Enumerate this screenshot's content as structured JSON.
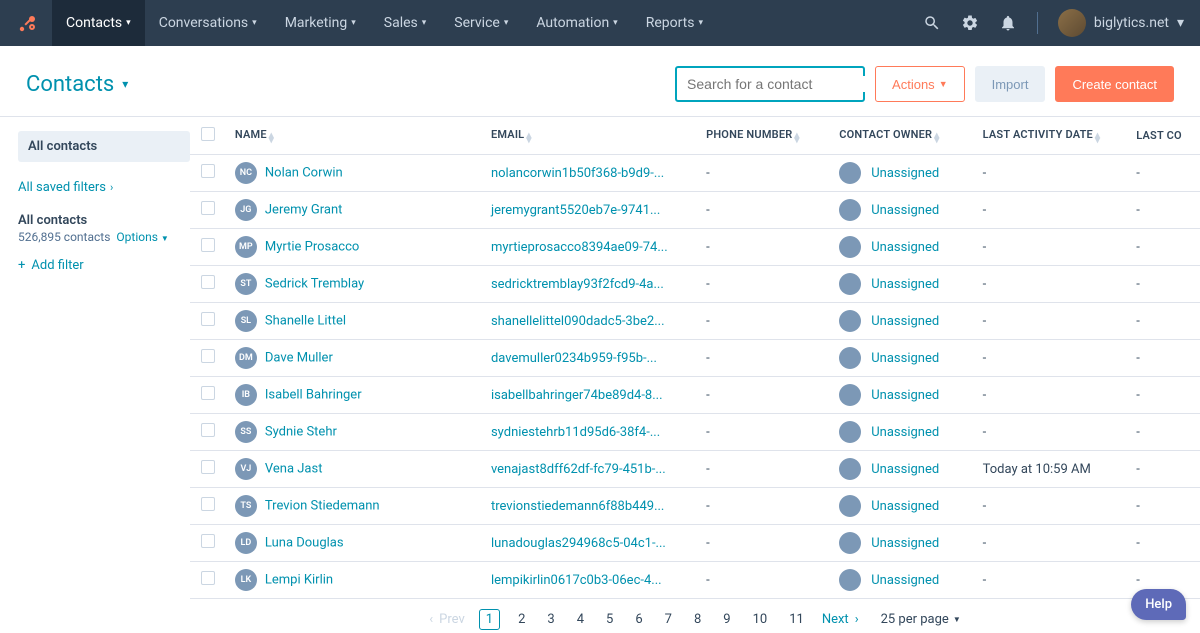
{
  "nav": {
    "items": [
      {
        "label": "Contacts",
        "active": true
      },
      {
        "label": "Conversations"
      },
      {
        "label": "Marketing"
      },
      {
        "label": "Sales"
      },
      {
        "label": "Service"
      },
      {
        "label": "Automation"
      },
      {
        "label": "Reports"
      }
    ],
    "account": "biglytics.net"
  },
  "page": {
    "title": "Contacts",
    "search_placeholder": "Search for a contact",
    "actions_label": "Actions",
    "import_label": "Import",
    "create_label": "Create contact"
  },
  "sidebar": {
    "all_contacts": "All contacts",
    "saved_filters": "All saved filters",
    "current": {
      "title": "All contacts",
      "count": "526,895 contacts",
      "options": "Options"
    },
    "add_filter": "Add filter"
  },
  "table": {
    "columns": [
      "NAME",
      "EMAIL",
      "PHONE NUMBER",
      "CONTACT OWNER",
      "LAST ACTIVITY DATE",
      "LAST CO"
    ],
    "rows": [
      {
        "initials": "NC",
        "name": "Nolan Corwin",
        "email": "nolancorwin1b50f368-b9d9-...",
        "phone": "-",
        "owner": "Unassigned",
        "activity": "-",
        "lastc": "-"
      },
      {
        "initials": "JG",
        "name": "Jeremy Grant",
        "email": "jeremygrant5520eb7e-9741...",
        "phone": "-",
        "owner": "Unassigned",
        "activity": "-",
        "lastc": "-"
      },
      {
        "initials": "MP",
        "name": "Myrtie Prosacco",
        "email": "myrtieprosacco8394ae09-74...",
        "phone": "-",
        "owner": "Unassigned",
        "activity": "-",
        "lastc": "-"
      },
      {
        "initials": "ST",
        "name": "Sedrick Tremblay",
        "email": "sedricktremblay93f2fcd9-4a...",
        "phone": "-",
        "owner": "Unassigned",
        "activity": "-",
        "lastc": "-"
      },
      {
        "initials": "SL",
        "name": "Shanelle Littel",
        "email": "shanellelittel090dadc5-3be2...",
        "phone": "-",
        "owner": "Unassigned",
        "activity": "-",
        "lastc": "-"
      },
      {
        "initials": "DM",
        "name": "Dave Muller",
        "email": "davemuller0234b959-f95b-...",
        "phone": "-",
        "owner": "Unassigned",
        "activity": "-",
        "lastc": "-"
      },
      {
        "initials": "IB",
        "name": "Isabell Bahringer",
        "email": "isabellbahringer74be89d4-8...",
        "phone": "-",
        "owner": "Unassigned",
        "activity": "-",
        "lastc": "-"
      },
      {
        "initials": "SS",
        "name": "Sydnie Stehr",
        "email": "sydniestehrb11d95d6-38f4-...",
        "phone": "-",
        "owner": "Unassigned",
        "activity": "-",
        "lastc": "-"
      },
      {
        "initials": "VJ",
        "name": "Vena Jast",
        "email": "venajast8dff62df-fc79-451b-...",
        "phone": "-",
        "owner": "Unassigned",
        "activity": "Today at 10:59 AM",
        "lastc": "-"
      },
      {
        "initials": "TS",
        "name": "Trevion Stiedemann",
        "email": "trevionstiedemann6f88b449...",
        "phone": "-",
        "owner": "Unassigned",
        "activity": "-",
        "lastc": "-"
      },
      {
        "initials": "LD",
        "name": "Luna Douglas",
        "email": "lunadouglas294968c5-04c1-...",
        "phone": "-",
        "owner": "Unassigned",
        "activity": "-",
        "lastc": "-"
      },
      {
        "initials": "LK",
        "name": "Lempi Kirlin",
        "email": "lempikirlin0617c0b3-06ec-4...",
        "phone": "-",
        "owner": "Unassigned",
        "activity": "-",
        "lastc": "-"
      }
    ]
  },
  "pager": {
    "prev": "Prev",
    "next": "Next",
    "pages": [
      "1",
      "2",
      "3",
      "4",
      "5",
      "6",
      "7",
      "8",
      "9",
      "10",
      "11"
    ],
    "per_page": "25 per page"
  },
  "help": "Help"
}
